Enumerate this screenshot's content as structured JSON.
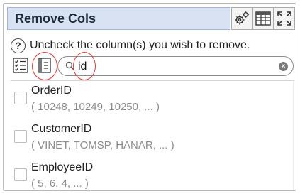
{
  "panel": {
    "title": "Remove Cols",
    "icons": {
      "settings": "gears-icon",
      "table": "table-icon",
      "expand": "expand-icon"
    }
  },
  "instruction": {
    "help_glyph": "?",
    "text": "Uncheck the column(s) you wish to remove."
  },
  "toolbar": {
    "check_all_icon": "checklist-icon",
    "list_icon": "list-icon",
    "highlight_color": "#e23b3b"
  },
  "search": {
    "value": "id",
    "clear_glyph": "×"
  },
  "columns": [
    {
      "name": "OrderID",
      "sample": "( 10248, 10249, 10250, ... )",
      "checked": false
    },
    {
      "name": "CustomerID",
      "sample": "( VINET, TOMSP, HANAR, ... )",
      "checked": false
    },
    {
      "name": "EmployeeID",
      "sample": "( 5, 6, 4, ... )",
      "checked": false
    }
  ]
}
